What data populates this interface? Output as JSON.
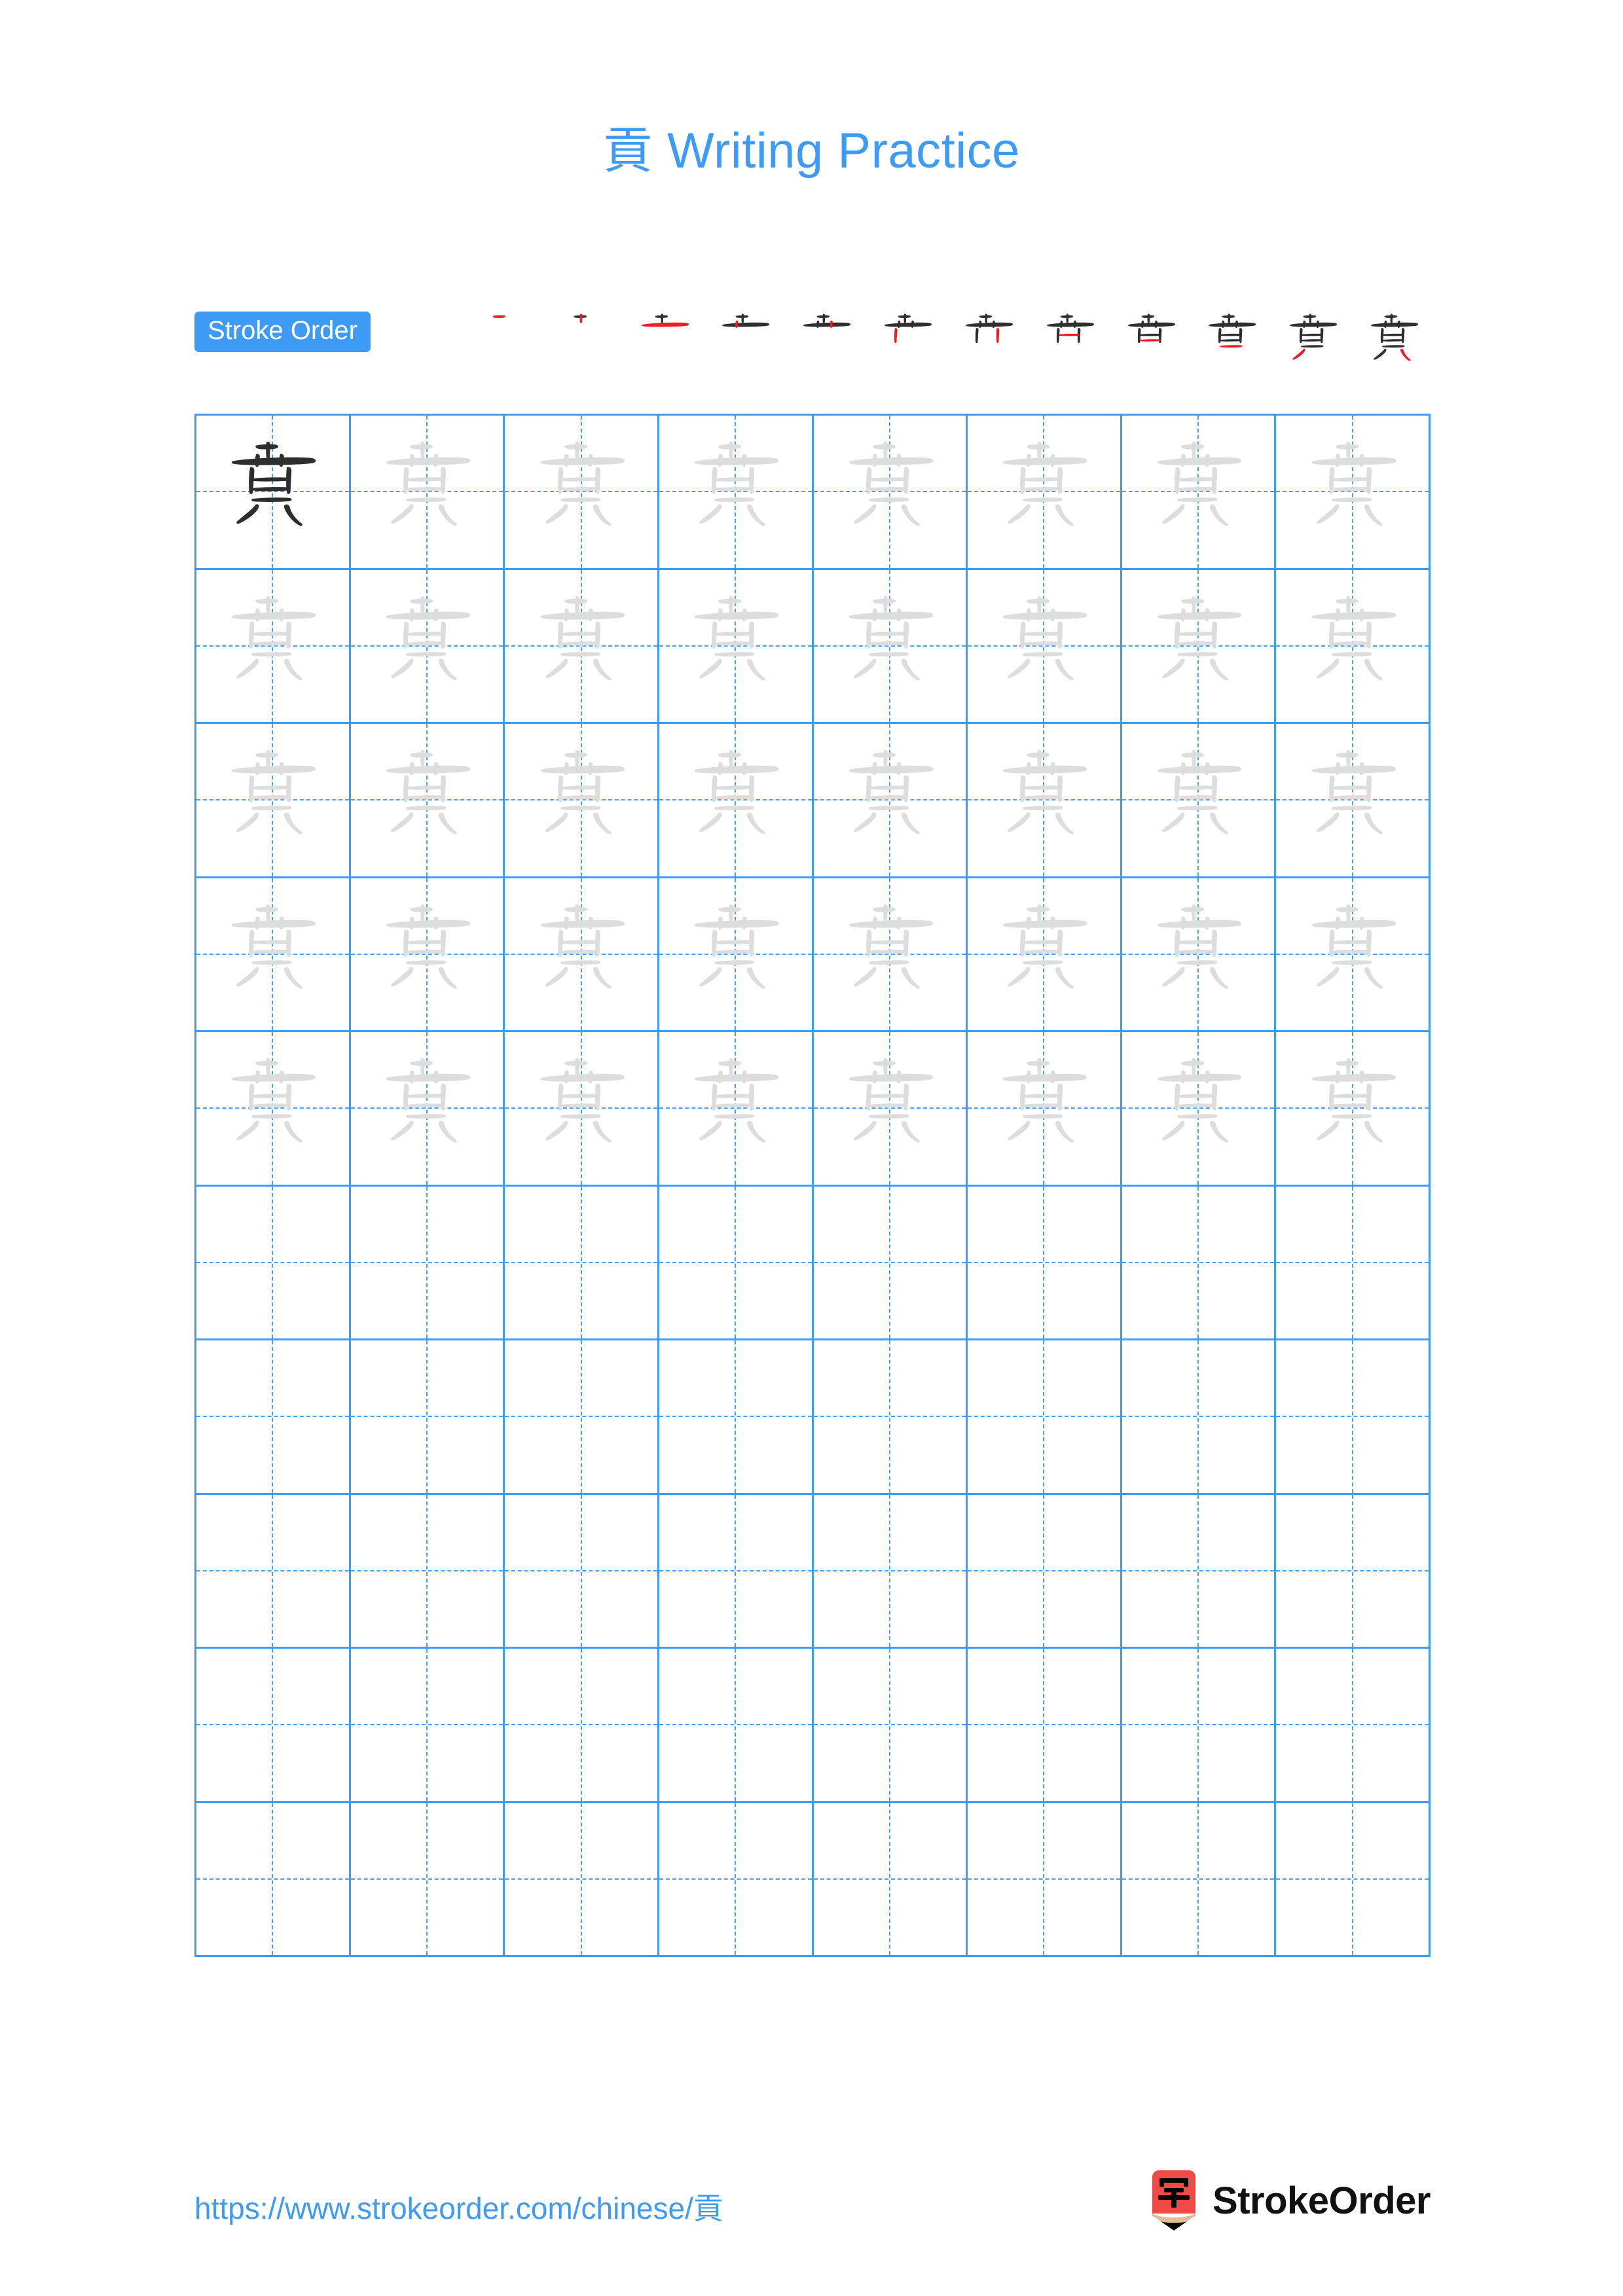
{
  "document": {
    "character": "貢",
    "title_suffix": " Writing Practice",
    "title_full": "貢 Writing Practice",
    "title_color": "#3d9bf5",
    "background_color": "#ffffff"
  },
  "stroke_order": {
    "badge_label": "Stroke Order",
    "badge_bg_color": "#3d9bf5",
    "badge_text_color": "#ffffff",
    "existing_stroke_color": "#2e2e2e",
    "new_stroke_color": "#ef1c21",
    "step_count": 12,
    "steps": [
      {
        "index": 1,
        "strokes_shown": 1
      },
      {
        "index": 2,
        "strokes_shown": 2
      },
      {
        "index": 3,
        "strokes_shown": 3
      },
      {
        "index": 4,
        "strokes_shown": 4
      },
      {
        "index": 5,
        "strokes_shown": 5
      },
      {
        "index": 6,
        "strokes_shown": 6
      },
      {
        "index": 7,
        "strokes_shown": 7
      },
      {
        "index": 8,
        "strokes_shown": 8
      },
      {
        "index": 9,
        "strokes_shown": 9
      },
      {
        "index": 10,
        "strokes_shown": 10
      },
      {
        "index": 11,
        "strokes_shown": 11
      },
      {
        "index": 12,
        "strokes_shown": 12
      }
    ]
  },
  "practice_grid": {
    "columns": 8,
    "rows": 10,
    "grid_line_color": "#3d9bf5",
    "guide_line_color": "#4a9ff5",
    "model_char_color": "#2e2e2e",
    "trace_char_color": "#dddddd",
    "rows_data": [
      [
        "dark",
        "light",
        "light",
        "light",
        "light",
        "light",
        "light",
        "light"
      ],
      [
        "light",
        "light",
        "light",
        "light",
        "light",
        "light",
        "light",
        "light"
      ],
      [
        "light",
        "light",
        "light",
        "light",
        "light",
        "light",
        "light",
        "light"
      ],
      [
        "light",
        "light",
        "light",
        "light",
        "light",
        "light",
        "light",
        "light"
      ],
      [
        "light",
        "light",
        "light",
        "light",
        "light",
        "light",
        "light",
        "light"
      ],
      [
        "empty",
        "empty",
        "empty",
        "empty",
        "empty",
        "empty",
        "empty",
        "empty"
      ],
      [
        "empty",
        "empty",
        "empty",
        "empty",
        "empty",
        "empty",
        "empty",
        "empty"
      ],
      [
        "empty",
        "empty",
        "empty",
        "empty",
        "empty",
        "empty",
        "empty",
        "empty"
      ],
      [
        "empty",
        "empty",
        "empty",
        "empty",
        "empty",
        "empty",
        "empty",
        "empty"
      ],
      [
        "empty",
        "empty",
        "empty",
        "empty",
        "empty",
        "empty",
        "empty",
        "empty"
      ]
    ]
  },
  "footer": {
    "url": "https://www.strokeorder.com/chinese/貢",
    "url_color": "#3d9bf5",
    "brand_name": "StrokeOrder",
    "brand_logo_char": "字",
    "brand_logo_bg_color": "#ef4a45",
    "brand_logo_wood_color": "#e0bd93"
  }
}
